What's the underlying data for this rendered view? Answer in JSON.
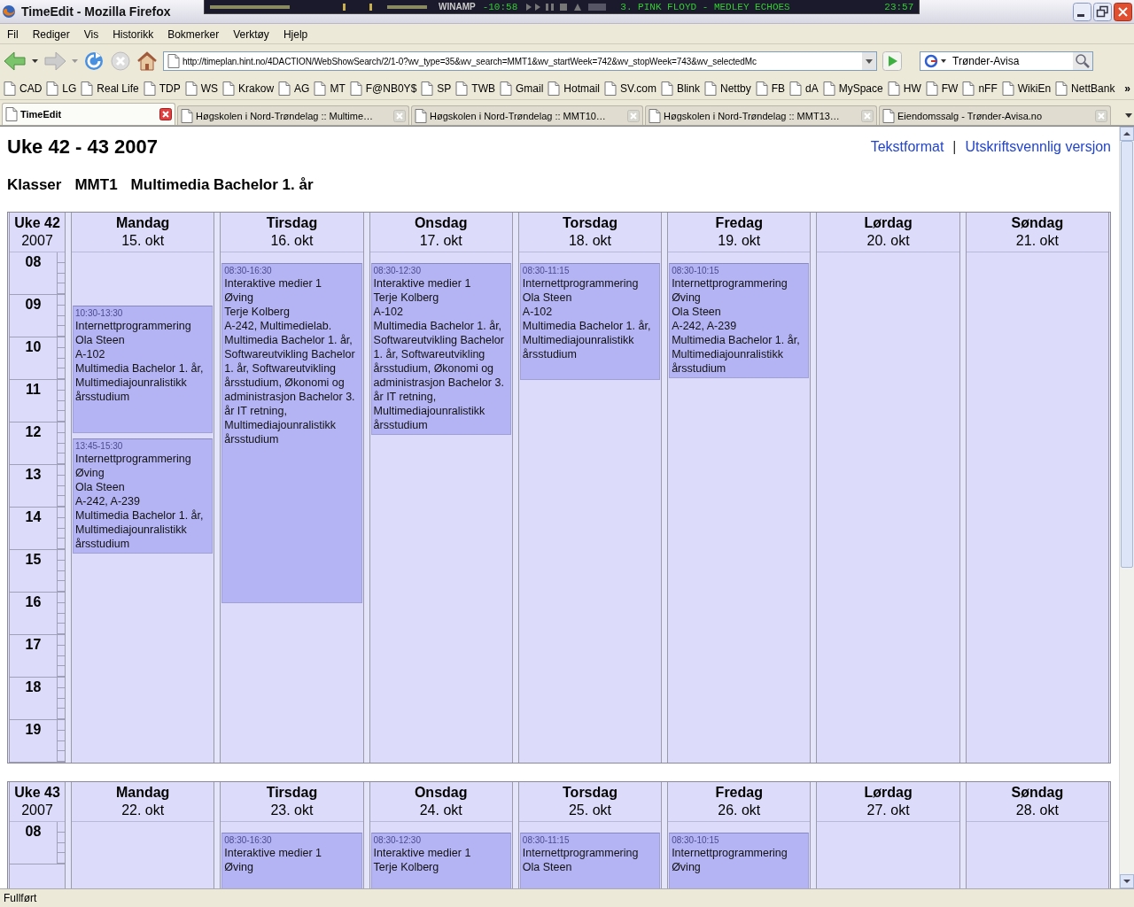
{
  "window": {
    "title": "TimeEdit - Mozilla Firefox"
  },
  "player": {
    "name": "WINAMP",
    "elapsed": "-10:58",
    "track": "3. PINK FLOYD - MEDLEY ECHOES",
    "length": "23:57"
  },
  "menu": [
    "Fil",
    "Rediger",
    "Vis",
    "Historikk",
    "Bokmerker",
    "Verktøy",
    "Hjelp"
  ],
  "address": {
    "value": "http://timeplan.hint.no/4DACTION/WebShowSearch/2/1-0?wv_type=35&wv_search=MMT1&wv_startWeek=742&wv_stopWeek=743&wv_selectedMc"
  },
  "search": {
    "value": "Trønder-Avisa"
  },
  "bookmarks": [
    "CAD",
    "LG",
    "Real Life",
    "TDP",
    "WS",
    "Krakow",
    "AG",
    "MT",
    "F@NB0Y$",
    "SP",
    "TWB",
    "Gmail",
    "Hotmail",
    "SV.com",
    "Blink",
    "Nettby",
    "FB",
    "dA",
    "MySpace",
    "HW",
    "FW",
    "nFF",
    "WikiEn",
    "NettBank"
  ],
  "bookmarks_more": "»",
  "tabs": [
    {
      "label": "TimeEdit",
      "selected": true
    },
    {
      "label": "Høgskolen i Nord-Trøndelag :: Multime…",
      "selected": false
    },
    {
      "label": "Høgskolen i Nord-Trøndelag :: MMT10…",
      "selected": false
    },
    {
      "label": "Høgskolen i Nord-Trøndelag :: MMT13…",
      "selected": false
    },
    {
      "label": "Eiendomssalg - Trønder-Avisa.no",
      "selected": false
    }
  ],
  "page": {
    "title": "Uke 42 - 43 2007",
    "links": [
      "Tekstformat",
      "Utskriftsvennlig versjon"
    ],
    "separator": "|",
    "subtitle": [
      "Klasser",
      "MMT1",
      "Multimedia Bachelor 1. år"
    ]
  },
  "weeks": [
    {
      "label": "Uke 42",
      "year": "2007",
      "hours": [
        "08",
        "09",
        "10",
        "11",
        "12",
        "13",
        "14",
        "15",
        "16",
        "17",
        "18",
        "19"
      ],
      "days": [
        {
          "name": "Mandag",
          "date": "15. okt",
          "events": [
            {
              "time": "10:30-13:30",
              "lines": [
                "Internettprogrammering",
                "Ola Steen",
                "A-102",
                "Multimedia Bachelor 1. år, Multimediajounralistikk årsstudium"
              ]
            },
            {
              "time": "13:45-15:30",
              "lines": [
                "Internettprogrammering",
                "Øving",
                "Ola Steen",
                "A-242, A-239",
                "Multimedia Bachelor 1. år, Multimediajounralistikk årsstudium"
              ]
            }
          ]
        },
        {
          "name": "Tirsdag",
          "date": "16. okt",
          "events": [
            {
              "time": "08:30-16:30",
              "lines": [
                "Interaktive medier 1",
                "Øving",
                "Terje Kolberg",
                "A-242, Multimedielab.",
                "Multimedia Bachelor 1. år, Softwareutvikling Bachelor 1. år, Softwareutvikling årsstudium, Økonomi og administrasjon Bachelor 3. år IT retning, Multimediajounralistikk årsstudium"
              ]
            }
          ]
        },
        {
          "name": "Onsdag",
          "date": "17. okt",
          "events": [
            {
              "time": "08:30-12:30",
              "lines": [
                "Interaktive medier 1",
                "Terje Kolberg",
                "A-102",
                "Multimedia Bachelor 1. år, Softwareutvikling Bachelor 1. år, Softwareutvikling årsstudium, Økonomi og administrasjon Bachelor 3. år IT retning, Multimediajounralistikk årsstudium"
              ]
            }
          ]
        },
        {
          "name": "Torsdag",
          "date": "18. okt",
          "events": [
            {
              "time": "08:30-11:15",
              "lines": [
                "Internettprogrammering",
                "Ola Steen",
                "A-102",
                "Multimedia Bachelor 1. år, Multimediajounralistikk årsstudium"
              ]
            }
          ]
        },
        {
          "name": "Fredag",
          "date": "19. okt",
          "events": [
            {
              "time": "08:30-10:15",
              "lines": [
                "Internettprogrammering",
                "Øving",
                "Ola Steen",
                "A-242, A-239",
                "Multimedia Bachelor 1. år, Multimediajounralistikk årsstudium"
              ]
            }
          ]
        },
        {
          "name": "Lørdag",
          "date": "20. okt"
        },
        {
          "name": "Søndag",
          "date": "21. okt"
        }
      ]
    },
    {
      "label": "Uke 43",
      "year": "2007",
      "hours": [
        "08"
      ],
      "days": [
        {
          "name": "Mandag",
          "date": "22. okt"
        },
        {
          "name": "Tirsdag",
          "date": "23. okt",
          "events": [
            {
              "time": "08:30-16:30",
              "lines": [
                "Interaktive medier 1",
                "Øving"
              ]
            }
          ]
        },
        {
          "name": "Onsdag",
          "date": "24. okt",
          "events": [
            {
              "time": "08:30-12:30",
              "lines": [
                "Interaktive medier 1",
                "Terje Kolberg"
              ]
            }
          ]
        },
        {
          "name": "Torsdag",
          "date": "25. okt",
          "events": [
            {
              "time": "08:30-11:15",
              "lines": [
                "Internettprogrammering",
                "Ola Steen"
              ]
            }
          ]
        },
        {
          "name": "Fredag",
          "date": "26. okt",
          "events": [
            {
              "time": "08:30-10:15",
              "lines": [
                "Internettprogrammering",
                "Øving"
              ]
            }
          ]
        },
        {
          "name": "Lørdag",
          "date": "27. okt"
        },
        {
          "name": "Søndag",
          "date": "28. okt"
        }
      ]
    }
  ],
  "status_bar": {
    "text": "Fullført"
  }
}
